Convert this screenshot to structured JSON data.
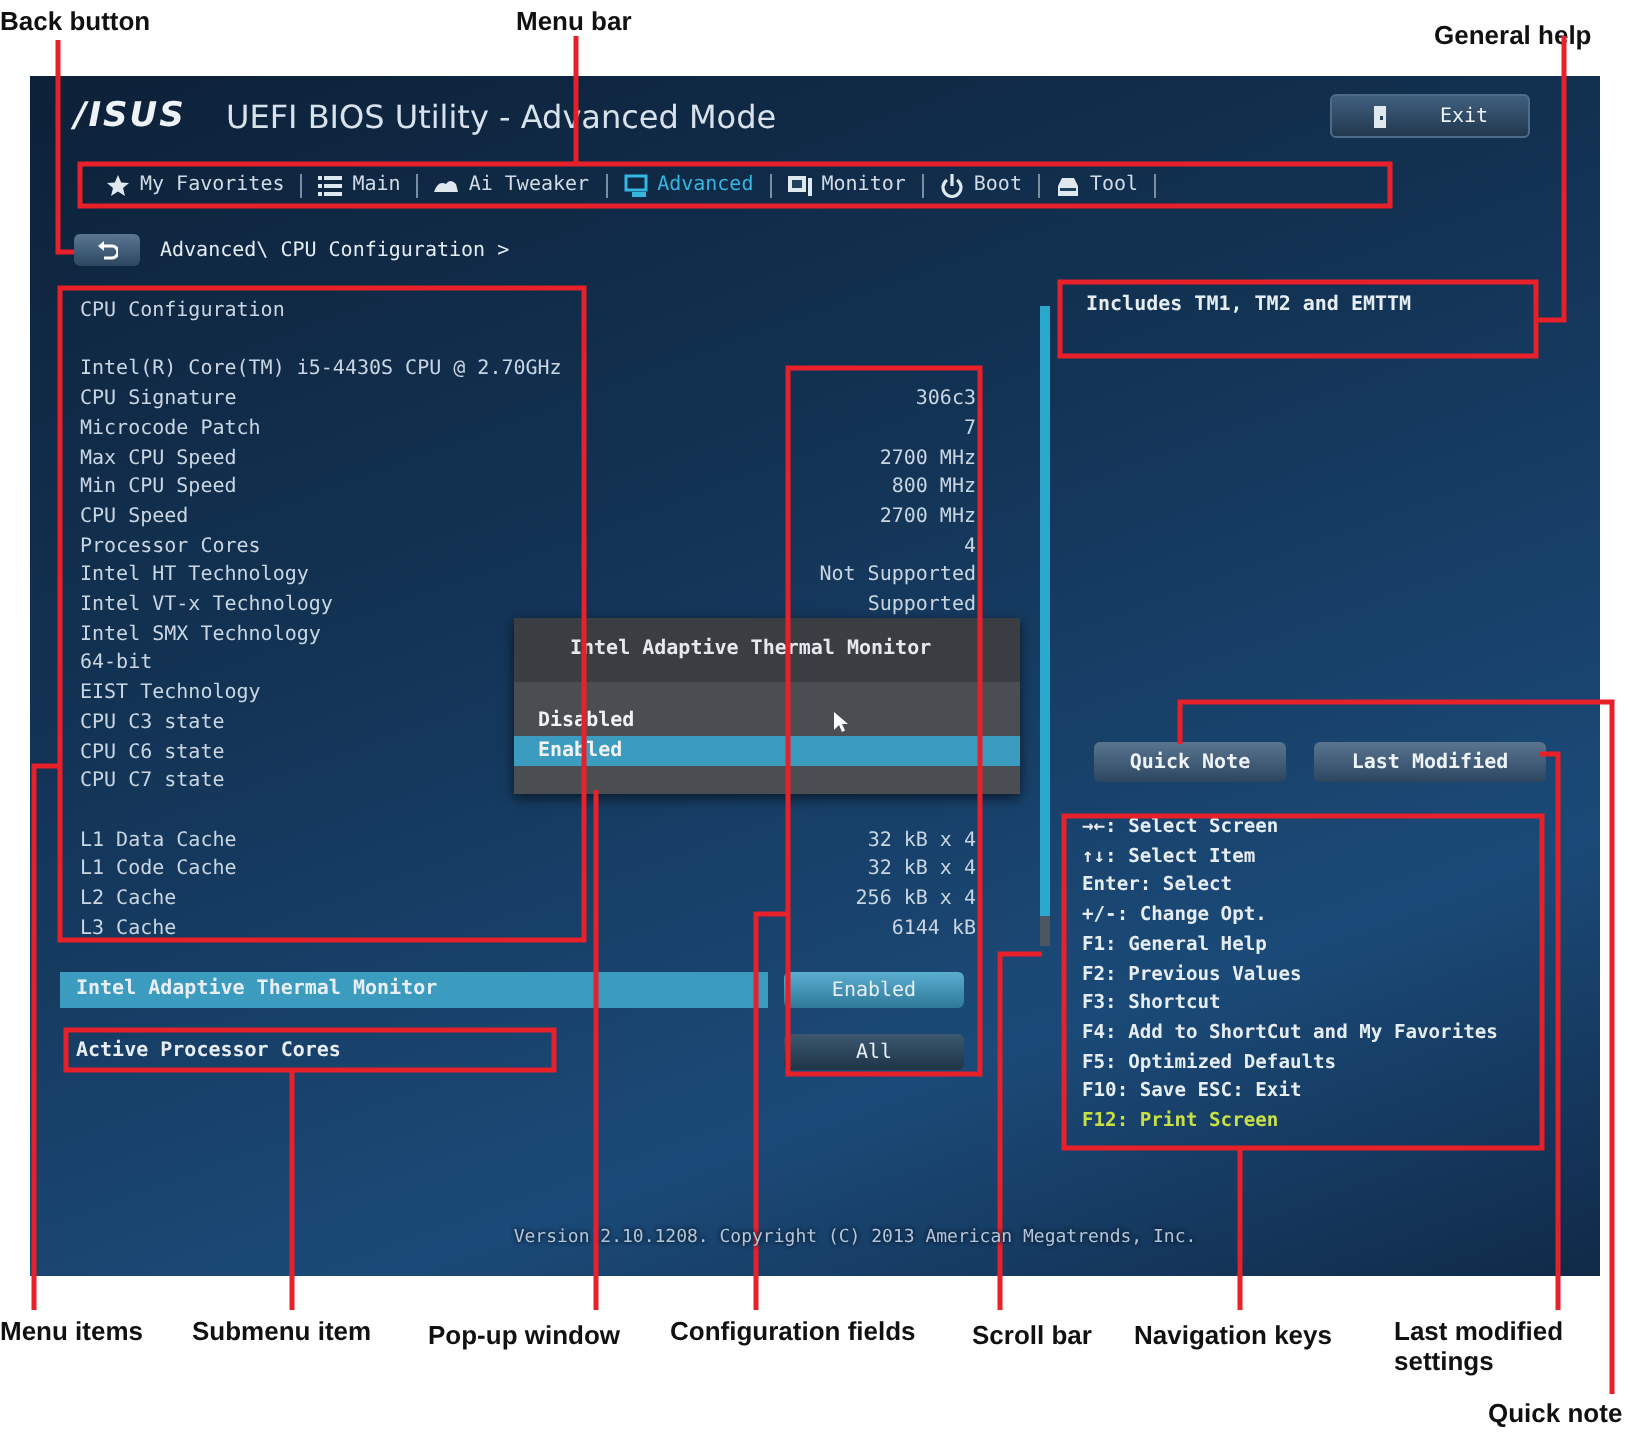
{
  "callouts_top": [
    "Back button",
    "Menu bar",
    "General help"
  ],
  "window": {
    "logo": "/ISUS",
    "title": "UEFI BIOS Utility - Advanced Mode",
    "exit_button": "Exit"
  },
  "tabs": [
    {
      "label": "My Favorites",
      "selected": false
    },
    {
      "label": "Main",
      "selected": false
    },
    {
      "label": "Ai Tweaker",
      "selected": false
    },
    {
      "label": "Advanced",
      "selected": true
    },
    {
      "label": "Monitor",
      "selected": false
    },
    {
      "label": "Boot",
      "selected": false
    },
    {
      "label": "Tool",
      "selected": false
    }
  ],
  "breadcrumb": "Advanced\\ CPU Configuration >",
  "info_sections": [
    {
      "title": "CPU Configuration"
    },
    {
      "rows": [
        {
          "label": "Intel(R) Core(TM) i5-4430S CPU @ 2.70GHz"
        },
        {
          "label": "CPU Signature",
          "value": "306c3"
        },
        {
          "label": "Microcode Patch",
          "value": "7"
        },
        {
          "label": "Max CPU Speed",
          "value": "2700 MHz"
        },
        {
          "label": "Min CPU Speed",
          "value": "800 MHz"
        },
        {
          "label": "CPU Speed",
          "value": "2700 MHz"
        },
        {
          "label": "Processor Cores",
          "value": "4"
        },
        {
          "label": "Intel HT Technology",
          "value": "Not Supported"
        },
        {
          "label": "Intel VT-x Technology",
          "value": "Supported"
        },
        {
          "label": "Intel SMX Technology"
        },
        {
          "label": "64-bit"
        },
        {
          "label": "EIST Technology"
        },
        {
          "label": "CPU C3 state"
        },
        {
          "label": "CPU C6 state"
        },
        {
          "label": "CPU C7 state"
        }
      ]
    },
    {
      "rows": [
        {
          "label": "L1 Data Cache",
          "value": "32 kB x 4"
        },
        {
          "label": "L1 Code Cache",
          "value": "32 kB x 4"
        },
        {
          "label": "L2 Cache",
          "value": "256 kB x 4"
        },
        {
          "label": "L3 Cache",
          "value": "6144 kB"
        }
      ]
    }
  ],
  "settings": [
    {
      "label": "Intel Adaptive Thermal Monitor",
      "value": "Enabled",
      "selected": true
    },
    {
      "label": "Active Processor Cores",
      "value": "All",
      "selected": false
    }
  ],
  "popup": {
    "title": "Intel Adaptive Thermal Monitor",
    "options": [
      {
        "label": "Disabled",
        "selected": false
      },
      {
        "label": "Enabled",
        "selected": true
      }
    ]
  },
  "help_text": "Includes TM1, TM2 and EMTTM",
  "side_buttons": [
    "Quick Note",
    "Last Modified"
  ],
  "nav_keys": [
    {
      "text": "→←: Select Screen",
      "highlighted": false
    },
    {
      "text": "↑↓: Select Item",
      "highlighted": false
    },
    {
      "text": "Enter: Select",
      "highlighted": false
    },
    {
      "text": "+/-: Change Opt.",
      "highlighted": false
    },
    {
      "text": "F1: General Help",
      "highlighted": false
    },
    {
      "text": "F2: Previous Values",
      "highlighted": false
    },
    {
      "text": "F3: Shortcut",
      "highlighted": false
    },
    {
      "text": "F4: Add to ShortCut and My Favorites",
      "highlighted": false
    },
    {
      "text": "F5: Optimized Defaults",
      "highlighted": false
    },
    {
      "text": "F10: Save  ESC: Exit",
      "highlighted": false
    },
    {
      "text": "F12: Print Screen",
      "highlighted": true
    }
  ],
  "footer": "Version 2.10.1208. Copyright (C) 2013 American Megatrends, Inc.",
  "callouts_bottom": [
    "Menu items",
    "Submenu item",
    "Pop-up window",
    "Configuration fields",
    "Scroll bar",
    "Navigation keys",
    "Last modified settings",
    "Quick note"
  ]
}
